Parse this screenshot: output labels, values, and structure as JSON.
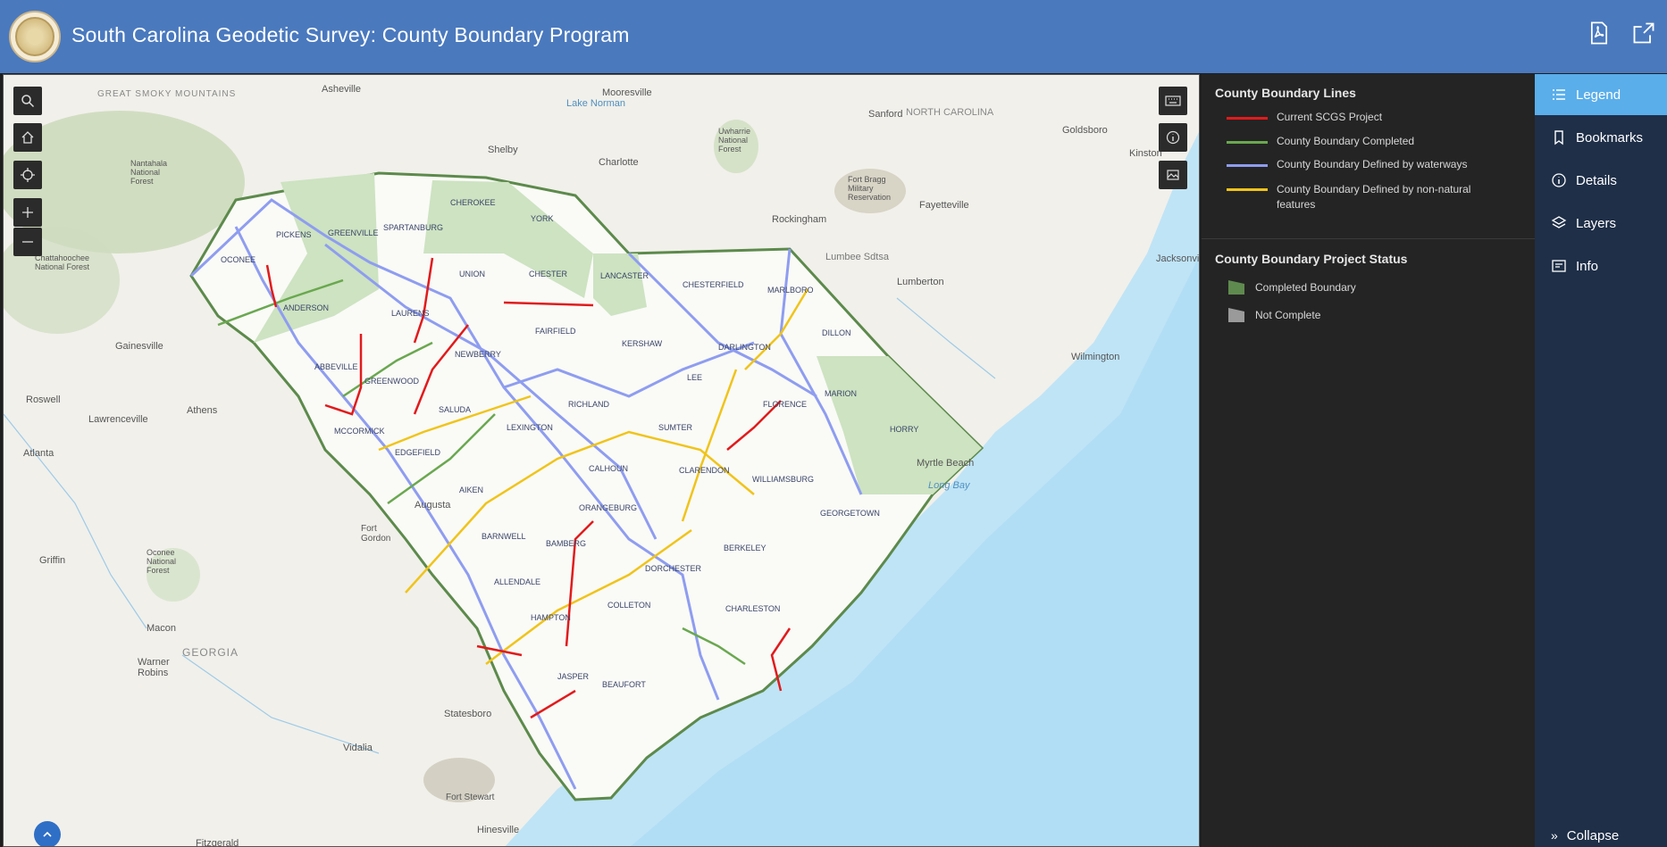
{
  "header": {
    "title": "South Carolina Geodetic Survey: County Boundary Program"
  },
  "legend": {
    "lines_title": "County Boundary Lines",
    "lines": [
      {
        "label": "Current SCGS Project",
        "color": "#e11b1b"
      },
      {
        "label": "County Boundary Completed",
        "color": "#6aa84f"
      },
      {
        "label": "County Boundary Defined by waterways",
        "color": "#8e9df0"
      },
      {
        "label": "County Boundary Defined by non-natural features",
        "color": "#f0c419"
      }
    ],
    "status_title": "County Boundary Project Status",
    "status": [
      {
        "label": "Completed Boundary",
        "color": "#5f8a4f"
      },
      {
        "label": "Not Complete",
        "color": "#9a9a9a"
      }
    ]
  },
  "sidebar": {
    "items": [
      {
        "label": "Legend",
        "icon": "list-icon",
        "active": true
      },
      {
        "label": "Bookmarks",
        "icon": "bookmark-icon"
      },
      {
        "label": "Details",
        "icon": "info-circle-icon"
      },
      {
        "label": "Layers",
        "icon": "layers-icon"
      },
      {
        "label": "Info",
        "icon": "info-card-icon"
      }
    ],
    "collapse_label": "Collapse"
  },
  "map": {
    "places": [
      {
        "text": "Asheville"
      },
      {
        "text": "Mooresville"
      },
      {
        "text": "Lake Norman"
      },
      {
        "text": "Shelby"
      },
      {
        "text": "Charlotte"
      },
      {
        "text": "Sanford"
      },
      {
        "text": "NORTH CAROLINA"
      },
      {
        "text": "Goldsboro"
      },
      {
        "text": "Kinston"
      },
      {
        "text": "Rockingham"
      },
      {
        "text": "Fayetteville"
      },
      {
        "text": "Lumbee Sdtsa"
      },
      {
        "text": "Lumberton"
      },
      {
        "text": "Wilmington"
      },
      {
        "text": "Jacksonville"
      },
      {
        "text": "Gainesville"
      },
      {
        "text": "Athens"
      },
      {
        "text": "Roswell"
      },
      {
        "text": "Lawrenceville"
      },
      {
        "text": "Atlanta"
      },
      {
        "text": "Griffin"
      },
      {
        "text": "Macon"
      },
      {
        "text": "GEORGIA"
      },
      {
        "text": "Warner Robins"
      },
      {
        "text": "Statesboro"
      },
      {
        "text": "Vidalia"
      },
      {
        "text": "Fort Stewart"
      },
      {
        "text": "Hinesville"
      },
      {
        "text": "Augusta"
      },
      {
        "text": "Fort Gordon"
      },
      {
        "text": "Myrtle Beach"
      },
      {
        "text": "Long Bay"
      },
      {
        "text": "Fort Bragg Military Reservation"
      },
      {
        "text": "Uwharrie National Forest"
      },
      {
        "text": "Nantahala National Forest"
      },
      {
        "text": "Chattahoochee National Forest"
      },
      {
        "text": "Oconee National Forest"
      },
      {
        "text": "GREAT SMOKY MOUNTAINS"
      },
      {
        "text": "Fitzgerald"
      }
    ],
    "counties": [
      "OCONEE",
      "PICKENS",
      "GREENVILLE",
      "SPARTANBURG",
      "CHEROKEE",
      "YORK",
      "ANDERSON",
      "LAURENS",
      "UNION",
      "CHESTER",
      "LANCASTER",
      "CHESTERFIELD",
      "MARLBORO",
      "ABBEVILLE",
      "GREENWOOD",
      "NEWBERRY",
      "FAIRFIELD",
      "KERSHAW",
      "DARLINGTON",
      "DILLON",
      "MCCORMICK",
      "SALUDA",
      "RICHLAND",
      "LEE",
      "FLORENCE",
      "MARION",
      "HORRY",
      "EDGEFIELD",
      "LEXINGTON",
      "SUMTER",
      "CALHOUN",
      "CLARENDON",
      "WILLIAMSBURG",
      "AIKEN",
      "ORANGEBURG",
      "GEORGETOWN",
      "BARNWELL",
      "BAMBERG",
      "BERKELEY",
      "DORCHESTER",
      "ALLENDALE",
      "CHARLESTON",
      "HAMPTON",
      "COLLETON",
      "JASPER",
      "BEAUFORT"
    ]
  }
}
